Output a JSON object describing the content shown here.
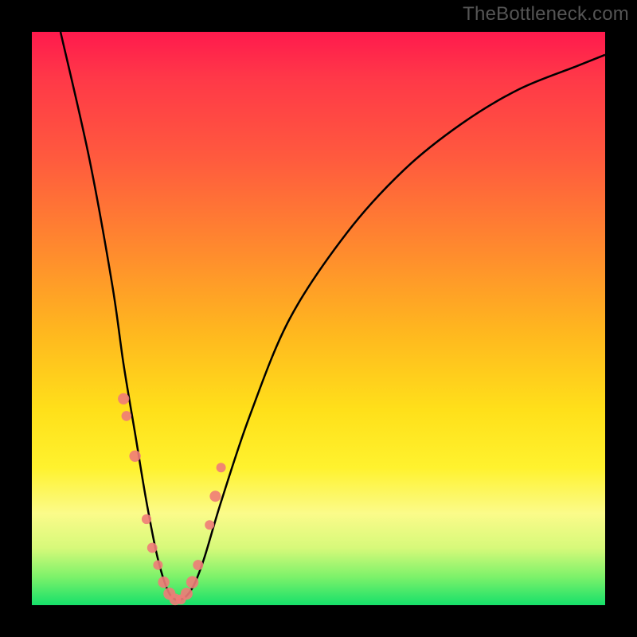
{
  "watermark": "TheBottleneck.com",
  "chart_data": {
    "type": "line",
    "title": "",
    "xlabel": "",
    "ylabel": "",
    "xlim": [
      0,
      100
    ],
    "ylim": [
      0,
      100
    ],
    "background_gradient_meaning": "optimal-at-bottom (green) to bottleneck-at-top (red)",
    "curve_description": "V-shaped bottleneck curve; steep left arm, shallower right arm, minimum near x≈25",
    "series": [
      {
        "name": "bottleneck-curve",
        "x": [
          5,
          10,
          14,
          16,
          18,
          20,
          22,
          24,
          26,
          28,
          30,
          33,
          38,
          45,
          55,
          65,
          75,
          85,
          95,
          100
        ],
        "y": [
          100,
          78,
          56,
          42,
          30,
          18,
          8,
          2,
          1,
          3,
          8,
          18,
          33,
          50,
          65,
          76,
          84,
          90,
          94,
          96
        ]
      },
      {
        "name": "marker-dots",
        "x": [
          16,
          16.5,
          18,
          20,
          21,
          22,
          23,
          24,
          25,
          26,
          27,
          28,
          29,
          31,
          32,
          33
        ],
        "y": [
          36,
          33,
          26,
          15,
          10,
          7,
          4,
          2,
          1,
          1,
          2,
          4,
          7,
          14,
          19,
          24
        ]
      }
    ]
  }
}
